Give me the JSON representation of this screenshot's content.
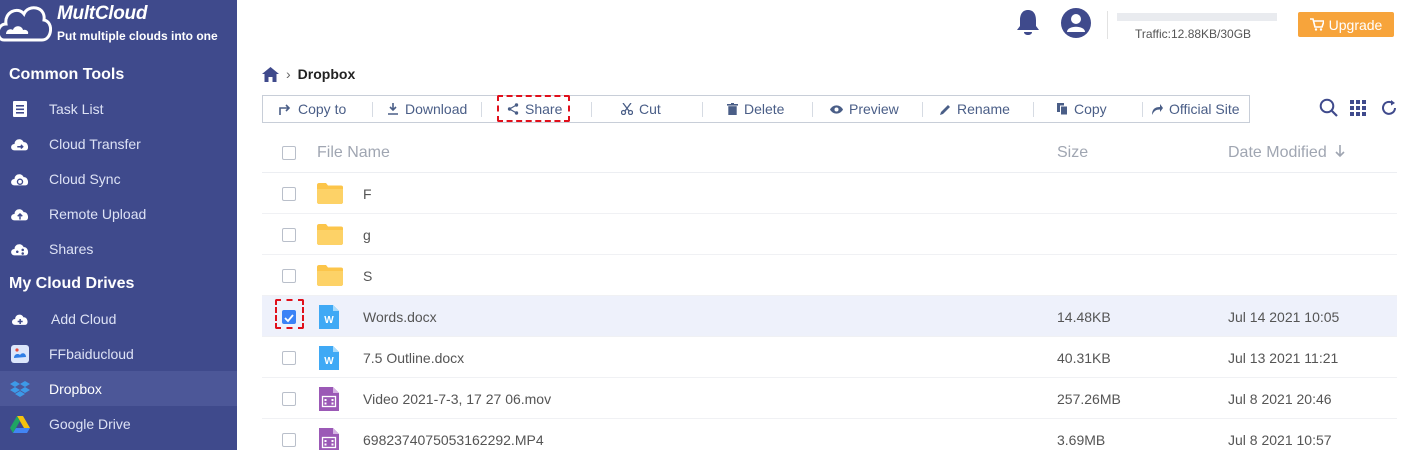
{
  "brand": {
    "name": "MultCloud",
    "tagline": "Put multiple clouds into one"
  },
  "sidebar": {
    "common_tools_title": "Common Tools",
    "common_tools": [
      {
        "label": "Task List",
        "icon": "task-list-icon"
      },
      {
        "label": "Cloud Transfer",
        "icon": "cloud-transfer-icon"
      },
      {
        "label": "Cloud Sync",
        "icon": "cloud-sync-icon"
      },
      {
        "label": "Remote Upload",
        "icon": "remote-upload-icon"
      },
      {
        "label": "Shares",
        "icon": "shares-icon"
      }
    ],
    "my_drives_title": "My Cloud Drives",
    "my_drives": [
      {
        "label": "Add Cloud",
        "icon": "add-cloud-icon"
      },
      {
        "label": "FFbaiducloud",
        "icon": "baidu-icon"
      },
      {
        "label": "Dropbox",
        "icon": "dropbox-icon",
        "active": true
      },
      {
        "label": "Google Drive",
        "icon": "google-drive-icon"
      }
    ]
  },
  "header": {
    "traffic": "Traffic:12.88KB/30GB",
    "traffic_used_fraction": 0.0004,
    "upgrade_label": "Upgrade"
  },
  "breadcrumb": {
    "current": "Dropbox"
  },
  "toolbar": {
    "copy_to": "Copy to",
    "download": "Download",
    "share": "Share",
    "cut": "Cut",
    "delete": "Delete",
    "preview": "Preview",
    "rename": "Rename",
    "copy": "Copy",
    "official_site": "Official Site"
  },
  "table": {
    "columns": {
      "name": "File Name",
      "size": "Size",
      "date": "Date Modified"
    },
    "sort": "date-descending",
    "rows": [
      {
        "name": "F",
        "type": "folder",
        "size": "",
        "date": "",
        "checked": false
      },
      {
        "name": "g",
        "type": "folder",
        "size": "",
        "date": "",
        "checked": false
      },
      {
        "name": "S",
        "type": "folder",
        "size": "",
        "date": "",
        "checked": false
      },
      {
        "name": "Words.docx",
        "type": "word",
        "size": "14.48KB",
        "date": "Jul 14 2021 10:05",
        "checked": true
      },
      {
        "name": "7.5 Outline.docx",
        "type": "word",
        "size": "40.31KB",
        "date": "Jul 13 2021 11:21",
        "checked": false
      },
      {
        "name": "Video 2021-7-3, 17 27 06.mov",
        "type": "video",
        "size": "257.26MB",
        "date": "Jul 8 2021 20:46",
        "checked": false
      },
      {
        "name": "6982374075053162292.MP4",
        "type": "video",
        "size": "3.69MB",
        "date": "Jul 8 2021 10:57",
        "checked": false
      }
    ]
  },
  "colors": {
    "sidebar": "#3f4a8c",
    "accent": "#f7a43b",
    "highlight": "#e0101b",
    "folder": "#fcc54a",
    "word": "#3fa9f5",
    "video": "#9b59b6"
  }
}
